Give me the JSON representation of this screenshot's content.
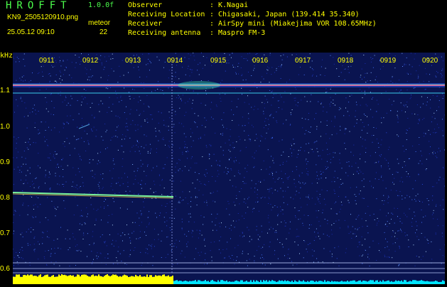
{
  "app": {
    "title": "HROFFT",
    "version": "1.0.0f",
    "filename": "KN9_2505120910.png",
    "datetime": "25.05.12 09:10",
    "meteor_label": "meteor",
    "meteor_count": "22"
  },
  "meta": [
    {
      "label": "Observer",
      "sep": ":",
      "value": "K.Nagai"
    },
    {
      "label": "Receiving Location",
      "sep": ":",
      "value": "Chigasaki, Japan (139.414 35.340)"
    },
    {
      "label": "Receiver",
      "sep": ":",
      "value": "AirSpy mini (Miakejima VOR 108.65MHz)"
    },
    {
      "label": "Receiving antenna",
      "sep": ":",
      "value": "Maspro FM-3"
    }
  ],
  "plot": {
    "unit": "kHz",
    "y_ticks": [
      "1.1",
      "1.0",
      "0.9",
      "0.8",
      "0.7",
      "0.6"
    ],
    "x_ticks": [
      "0911",
      "0912",
      "0913",
      "0914",
      "0915",
      "0916",
      "0917",
      "0918",
      "0919",
      "0920"
    ],
    "colors": {
      "background": "#0a1450",
      "carrier": "#ff6aa0",
      "reference": "#40e0ff",
      "level_high": "#ffff00",
      "level_low": "#00e5ff"
    }
  }
}
